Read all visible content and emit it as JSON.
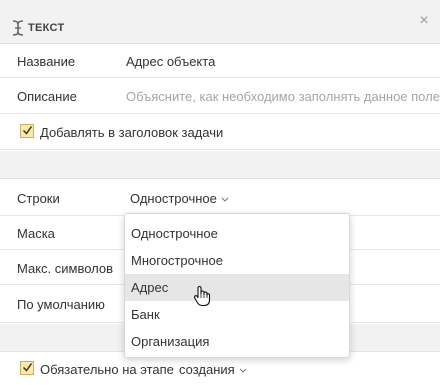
{
  "header": {
    "title": "ТЕКСТ",
    "icon": "text-cursor-icon",
    "close_icon": "close-icon",
    "close_glyph": "×"
  },
  "fields": {
    "name": {
      "label": "Название",
      "value": "Адрес объекта"
    },
    "description": {
      "label": "Описание",
      "placeholder": "Объясните, как необходимо заполнять данное поле"
    },
    "add_to_title": {
      "label": "Добавлять в заголовок задачи",
      "checked": true
    },
    "lines": {
      "label": "Строки",
      "value": "Однострочное"
    },
    "mask": {
      "label": "Маска"
    },
    "max_chars": {
      "label": "Макс. символов"
    },
    "default": {
      "label": "По умолчанию"
    },
    "required": {
      "label": "Обязательно на этапе",
      "checked": true,
      "stage_value": "создания"
    }
  },
  "dropdown": {
    "options": [
      "Однострочное",
      "Многострочное",
      "Адрес",
      "Банк",
      "Организация"
    ],
    "hovered_index": 2
  },
  "colors": {
    "checkbox_fill": "#fbe9a8",
    "header_bg": "#f2f2f2",
    "hover_bg": "#e6e6e6"
  }
}
